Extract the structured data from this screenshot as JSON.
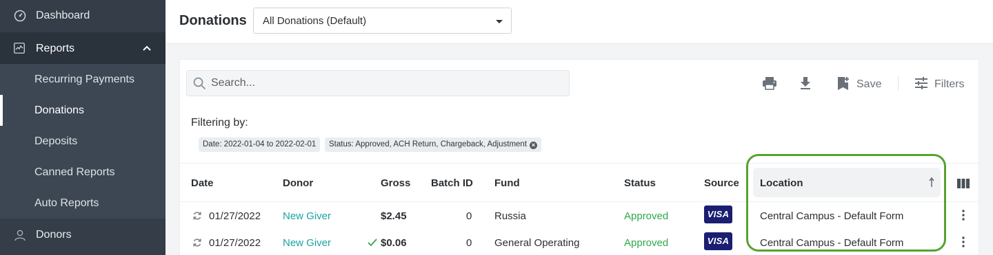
{
  "sidebar": {
    "dashboard": "Dashboard",
    "reports": "Reports",
    "sub_items": [
      "Recurring Payments",
      "Donations",
      "Deposits",
      "Canned Reports",
      "Auto Reports"
    ],
    "donors": "Donors"
  },
  "header": {
    "title": "Donations",
    "view_select": "All Donations (Default)"
  },
  "toolbar": {
    "search_placeholder": "Search...",
    "print_icon": "printer-icon",
    "download_icon": "download-icon",
    "save_label": "Save",
    "filters_label": "Filters"
  },
  "filters": {
    "label": "Filtering by:",
    "chips": [
      "Date: 2022-01-04 to 2022-02-01",
      "Status: Approved, ACH Return, Chargeback, Adjustment"
    ]
  },
  "table": {
    "columns": [
      "Date",
      "Donor",
      "Gross",
      "Batch ID",
      "Fund",
      "Status",
      "Source",
      "Location"
    ],
    "rows": [
      {
        "date": "01/27/2022",
        "donor": "New Giver",
        "gross": "$2.45",
        "batch": "0",
        "fund": "Russia",
        "status": "Approved",
        "source": "VISA",
        "location": "Central Campus - Default Form"
      },
      {
        "date": "01/27/2022",
        "donor": "New Giver",
        "gross": "$0.06",
        "batch": "0",
        "fund": "General Operating",
        "status": "Approved",
        "source": "VISA",
        "location": "Central Campus - Default Form"
      }
    ]
  },
  "colors": {
    "sidebar": "#343d48",
    "link": "#1aa3a3",
    "approved": "#2ea84a",
    "highlight": "#56a22e",
    "visa": "#1a1f71"
  }
}
